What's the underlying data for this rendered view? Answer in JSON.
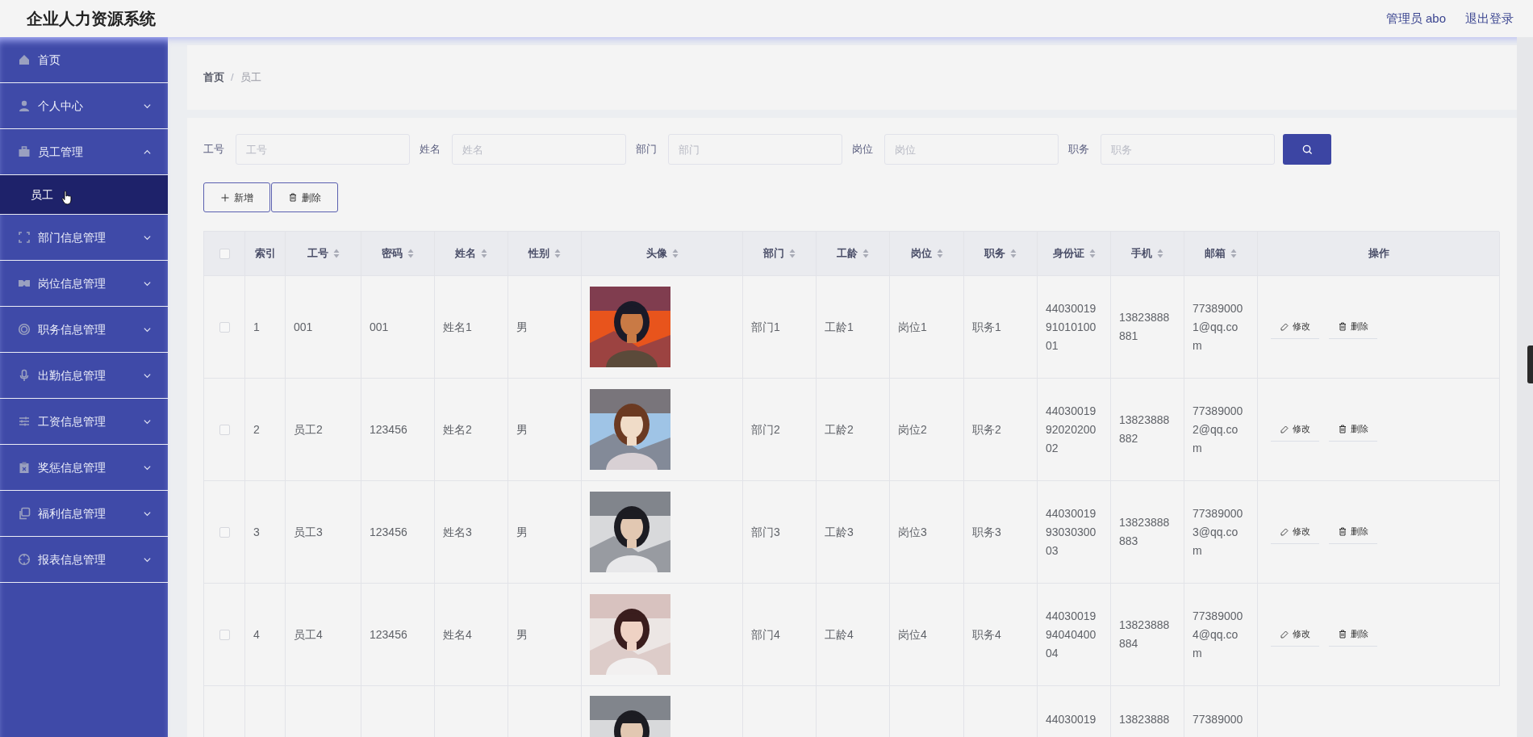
{
  "header": {
    "title": "企业人力资源系统",
    "user": "管理员 abo",
    "logout": "退出登录"
  },
  "sidebar": {
    "items": [
      {
        "label": "首页",
        "kind": "link"
      },
      {
        "label": "个人中心",
        "kind": "submenu",
        "expanded": false
      },
      {
        "label": "员工管理",
        "kind": "submenu",
        "expanded": true,
        "children": [
          {
            "label": "员工",
            "selected": true
          }
        ]
      },
      {
        "label": "部门信息管理",
        "kind": "submenu",
        "expanded": false
      },
      {
        "label": "岗位信息管理",
        "kind": "submenu",
        "expanded": false
      },
      {
        "label": "职务信息管理",
        "kind": "submenu",
        "expanded": false
      },
      {
        "label": "出勤信息管理",
        "kind": "submenu",
        "expanded": false
      },
      {
        "label": "工资信息管理",
        "kind": "submenu",
        "expanded": false
      },
      {
        "label": "奖惩信息管理",
        "kind": "submenu",
        "expanded": false
      },
      {
        "label": "福利信息管理",
        "kind": "submenu",
        "expanded": false
      },
      {
        "label": "报表信息管理",
        "kind": "submenu",
        "expanded": false
      }
    ]
  },
  "breadcrumb": [
    {
      "label": "首页",
      "current": false
    },
    {
      "label": "员工",
      "current": true
    }
  ],
  "breadcrumb_separator": "/",
  "filters": [
    {
      "label": "工号",
      "placeholder": "工号"
    },
    {
      "label": "姓名",
      "placeholder": "姓名"
    },
    {
      "label": "部门",
      "placeholder": "部门"
    },
    {
      "label": "岗位",
      "placeholder": "岗位"
    },
    {
      "label": "职务",
      "placeholder": "职务"
    }
  ],
  "toolbar": [
    {
      "label": "新增",
      "kind": "add"
    },
    {
      "label": "删除",
      "kind": "delete"
    }
  ],
  "table": {
    "select_all": false,
    "columns": [
      {
        "label": "索引",
        "kind": "text",
        "sortable": false
      },
      {
        "label": "工号",
        "kind": "text",
        "sortable": true
      },
      {
        "label": "密码",
        "kind": "text",
        "sortable": true
      },
      {
        "label": "姓名",
        "kind": "text",
        "sortable": true
      },
      {
        "label": "性别",
        "kind": "text",
        "sortable": true
      },
      {
        "label": "头像",
        "sortable": true
      },
      {
        "label": "部门",
        "kind": "text",
        "sortable": true
      },
      {
        "label": "工龄",
        "kind": "text",
        "sortable": true
      },
      {
        "label": "岗位",
        "kind": "text",
        "sortable": true
      },
      {
        "label": "职务",
        "kind": "text",
        "sortable": true
      },
      {
        "label": "身份证",
        "kind": "text",
        "sortable": true
      },
      {
        "label": "手机",
        "kind": "text",
        "sortable": true
      },
      {
        "label": "邮箱",
        "kind": "text",
        "sortable": true
      },
      {
        "label": "操作",
        "kind": "actions",
        "sortable": false
      }
    ],
    "rows": [
      {
        "kind": "full",
        "selected": false,
        "cells": [
          "1",
          "001",
          "001",
          "姓名1",
          "男",
          {
            "kind": "picture"
          },
          "部门1",
          "工龄1",
          "岗位1",
          "职务1",
          "440300199101010001",
          "13823888881",
          "773890001@qq.com"
        ],
        "actions": [
          "修改",
          "删除"
        ]
      },
      {
        "kind": "full",
        "selected": false,
        "cells": [
          "2",
          "员工2",
          "123456",
          "姓名2",
          "男",
          {
            "kind": "picture"
          },
          "部门2",
          "工龄2",
          "岗位2",
          "职务2",
          "440300199202020002",
          "13823888882",
          "773890002@qq.com"
        ],
        "actions": [
          "修改",
          "删除"
        ]
      },
      {
        "kind": "full",
        "selected": false,
        "cells": [
          "3",
          "员工3",
          "123456",
          "姓名3",
          "男",
          {
            "kind": "picture"
          },
          "部门3",
          "工龄3",
          "岗位3",
          "职务3",
          "440300199303030003",
          "13823888883",
          "773890003@qq.com"
        ],
        "actions": [
          "修改",
          "删除"
        ]
      },
      {
        "kind": "full",
        "selected": false,
        "cells": [
          "4",
          "员工4",
          "123456",
          "姓名4",
          "男",
          {
            "kind": "picture"
          },
          "部门4",
          "工龄4",
          "岗位4",
          "职务4",
          "440300199404040004",
          "13823888884",
          "773890004@qq.com"
        ],
        "actions": [
          "修改",
          "删除"
        ]
      },
      {
        "kind": "cut",
        "cells": [
          null,
          null,
          null,
          null,
          null,
          {
            "kind": "picture"
          },
          null,
          null,
          null,
          null,
          "44030019",
          "13823888",
          "77389000"
        ]
      }
    ]
  }
}
